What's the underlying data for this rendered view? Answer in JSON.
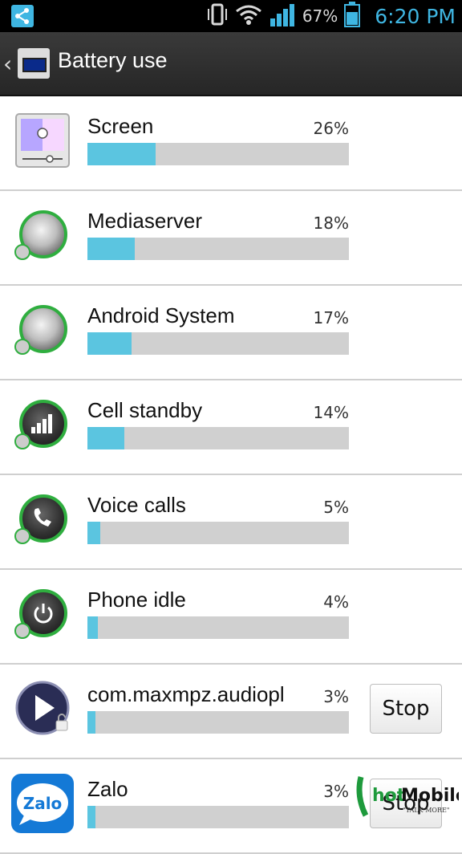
{
  "status_bar": {
    "battery_percent": "67%",
    "time": "6:20 PM"
  },
  "header": {
    "title": "Battery use"
  },
  "items": [
    {
      "name": "Screen",
      "percent": "26%",
      "value": 26,
      "icon": "screen-brightness-icon"
    },
    {
      "name": "Mediaserver",
      "percent": "18%",
      "value": 18,
      "icon": "system-knob-icon"
    },
    {
      "name": "Android System",
      "percent": "17%",
      "value": 17,
      "icon": "system-knob-icon"
    },
    {
      "name": "Cell standby",
      "percent": "14%",
      "value": 14,
      "icon": "signal-bars-icon"
    },
    {
      "name": "Voice calls",
      "percent": "5%",
      "value": 5,
      "icon": "phone-handset-icon"
    },
    {
      "name": "Phone idle",
      "percent": "4%",
      "value": 4,
      "icon": "power-icon"
    },
    {
      "name": "com.maxmpz.audiopl",
      "percent": "3%",
      "value": 3,
      "icon": "play-icon",
      "button": "Stop"
    },
    {
      "name": "Zalo",
      "percent": "3%",
      "value": 3,
      "icon": "zalo-icon",
      "button": "Stop"
    }
  ],
  "watermark": {
    "text": "hotMobile",
    "tagline": "TALK MORE"
  },
  "colors": {
    "accent": "#3fb6e2",
    "bar_fill": "#5bc5e0",
    "bar_track": "#d0d0d0",
    "knob_ring": "#2fae3f"
  }
}
